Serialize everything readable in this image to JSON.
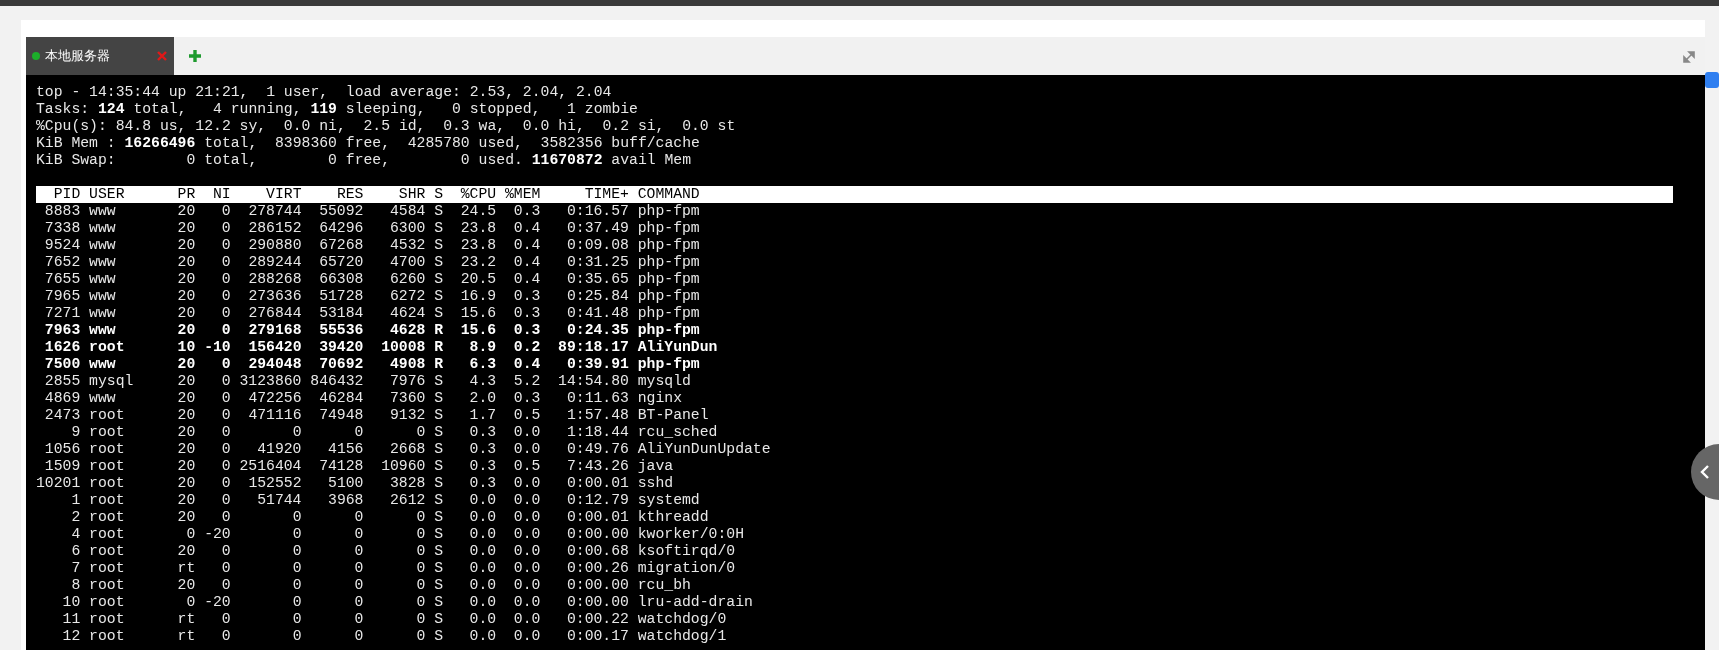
{
  "tabs": [
    {
      "label": "本地服务器",
      "selected": true,
      "connected": true
    }
  ],
  "summary_lines": [
    "top - 14:35:44 up 21:21,  1 user,  load average: 2.53, 2.04, 2.04",
    "Tasks: **124** total,   4 running, **119** sleeping,   0 stopped,   1 zombie",
    "%Cpu(s): 84.8 us, 12.2 sy,  0.0 ni,  2.5 id,  0.3 wa,  0.0 hi,  0.2 si,  0.0 st",
    "KiB Mem : **16266496** total,  8398360 free,  4285780 used,  3582356 buff/cache",
    "KiB Swap:        0 total,        0 free,        0 used. **11670872** avail Mem"
  ],
  "process_table": {
    "columns": [
      "PID",
      "USER",
      "PR",
      "NI",
      "VIRT",
      "RES",
      "SHR",
      "S",
      "%CPU",
      "%MEM",
      "TIME+",
      "COMMAND"
    ],
    "rows": [
      {
        "cells": [
          "8883",
          "www",
          "20",
          "0",
          "278744",
          "55092",
          "4584",
          "S",
          "24.5",
          "0.3",
          "0:16.57",
          "php-fpm"
        ],
        "bold": false
      },
      {
        "cells": [
          "7338",
          "www",
          "20",
          "0",
          "286152",
          "64296",
          "6300",
          "S",
          "23.8",
          "0.4",
          "0:37.49",
          "php-fpm"
        ],
        "bold": false
      },
      {
        "cells": [
          "9524",
          "www",
          "20",
          "0",
          "290880",
          "67268",
          "4532",
          "S",
          "23.8",
          "0.4",
          "0:09.08",
          "php-fpm"
        ],
        "bold": false
      },
      {
        "cells": [
          "7652",
          "www",
          "20",
          "0",
          "289244",
          "65720",
          "4700",
          "S",
          "23.2",
          "0.4",
          "0:31.25",
          "php-fpm"
        ],
        "bold": false
      },
      {
        "cells": [
          "7655",
          "www",
          "20",
          "0",
          "288268",
          "66308",
          "6260",
          "S",
          "20.5",
          "0.4",
          "0:35.65",
          "php-fpm"
        ],
        "bold": false
      },
      {
        "cells": [
          "7965",
          "www",
          "20",
          "0",
          "273636",
          "51728",
          "6272",
          "S",
          "16.9",
          "0.3",
          "0:25.84",
          "php-fpm"
        ],
        "bold": false
      },
      {
        "cells": [
          "7271",
          "www",
          "20",
          "0",
          "276844",
          "53184",
          "4624",
          "S",
          "15.6",
          "0.3",
          "0:41.48",
          "php-fpm"
        ],
        "bold": false
      },
      {
        "cells": [
          "7963",
          "www",
          "20",
          "0",
          "279168",
          "55536",
          "4628",
          "R",
          "15.6",
          "0.3",
          "0:24.35",
          "php-fpm"
        ],
        "bold": true
      },
      {
        "cells": [
          "1626",
          "root",
          "10",
          "-10",
          "156420",
          "39420",
          "10008",
          "R",
          "8.9",
          "0.2",
          "89:18.17",
          "AliYunDun"
        ],
        "bold": true
      },
      {
        "cells": [
          "7500",
          "www",
          "20",
          "0",
          "294048",
          "70692",
          "4908",
          "R",
          "6.3",
          "0.4",
          "0:39.91",
          "php-fpm"
        ],
        "bold": true
      },
      {
        "cells": [
          "2855",
          "mysql",
          "20",
          "0",
          "3123860",
          "846432",
          "7976",
          "S",
          "4.3",
          "5.2",
          "14:54.80",
          "mysqld"
        ],
        "bold": false
      },
      {
        "cells": [
          "4869",
          "www",
          "20",
          "0",
          "472256",
          "46284",
          "7360",
          "S",
          "2.0",
          "0.3",
          "0:11.63",
          "nginx"
        ],
        "bold": false
      },
      {
        "cells": [
          "2473",
          "root",
          "20",
          "0",
          "471116",
          "74948",
          "9132",
          "S",
          "1.7",
          "0.5",
          "1:57.48",
          "BT-Panel"
        ],
        "bold": false
      },
      {
        "cells": [
          "9",
          "root",
          "20",
          "0",
          "0",
          "0",
          "0",
          "S",
          "0.3",
          "0.0",
          "1:18.44",
          "rcu_sched"
        ],
        "bold": false
      },
      {
        "cells": [
          "1056",
          "root",
          "20",
          "0",
          "41920",
          "4156",
          "2668",
          "S",
          "0.3",
          "0.0",
          "0:49.76",
          "AliYunDunUpdate"
        ],
        "bold": false
      },
      {
        "cells": [
          "1509",
          "root",
          "20",
          "0",
          "2516404",
          "74128",
          "10960",
          "S",
          "0.3",
          "0.5",
          "7:43.26",
          "java"
        ],
        "bold": false
      },
      {
        "cells": [
          "10201",
          "root",
          "20",
          "0",
          "152552",
          "5100",
          "3828",
          "S",
          "0.3",
          "0.0",
          "0:00.01",
          "sshd"
        ],
        "bold": false
      },
      {
        "cells": [
          "1",
          "root",
          "20",
          "0",
          "51744",
          "3968",
          "2612",
          "S",
          "0.0",
          "0.0",
          "0:12.79",
          "systemd"
        ],
        "bold": false
      },
      {
        "cells": [
          "2",
          "root",
          "20",
          "0",
          "0",
          "0",
          "0",
          "S",
          "0.0",
          "0.0",
          "0:00.01",
          "kthreadd"
        ],
        "bold": false
      },
      {
        "cells": [
          "4",
          "root",
          "0",
          "-20",
          "0",
          "0",
          "0",
          "S",
          "0.0",
          "0.0",
          "0:00.00",
          "kworker/0:0H"
        ],
        "bold": false
      },
      {
        "cells": [
          "6",
          "root",
          "20",
          "0",
          "0",
          "0",
          "0",
          "S",
          "0.0",
          "0.0",
          "0:00.68",
          "ksoftirqd/0"
        ],
        "bold": false
      },
      {
        "cells": [
          "7",
          "root",
          "rt",
          "0",
          "0",
          "0",
          "0",
          "S",
          "0.0",
          "0.0",
          "0:00.26",
          "migration/0"
        ],
        "bold": false
      },
      {
        "cells": [
          "8",
          "root",
          "20",
          "0",
          "0",
          "0",
          "0",
          "S",
          "0.0",
          "0.0",
          "0:00.00",
          "rcu_bh"
        ],
        "bold": false
      },
      {
        "cells": [
          "10",
          "root",
          "0",
          "-20",
          "0",
          "0",
          "0",
          "S",
          "0.0",
          "0.0",
          "0:00.00",
          "lru-add-drain"
        ],
        "bold": false
      },
      {
        "cells": [
          "11",
          "root",
          "rt",
          "0",
          "0",
          "0",
          "0",
          "S",
          "0.0",
          "0.0",
          "0:00.22",
          "watchdog/0"
        ],
        "bold": false
      },
      {
        "cells": [
          "12",
          "root",
          "rt",
          "0",
          "0",
          "0",
          "0",
          "S",
          "0.0",
          "0.0",
          "0:00.17",
          "watchdog/1"
        ],
        "bold": false
      }
    ]
  }
}
